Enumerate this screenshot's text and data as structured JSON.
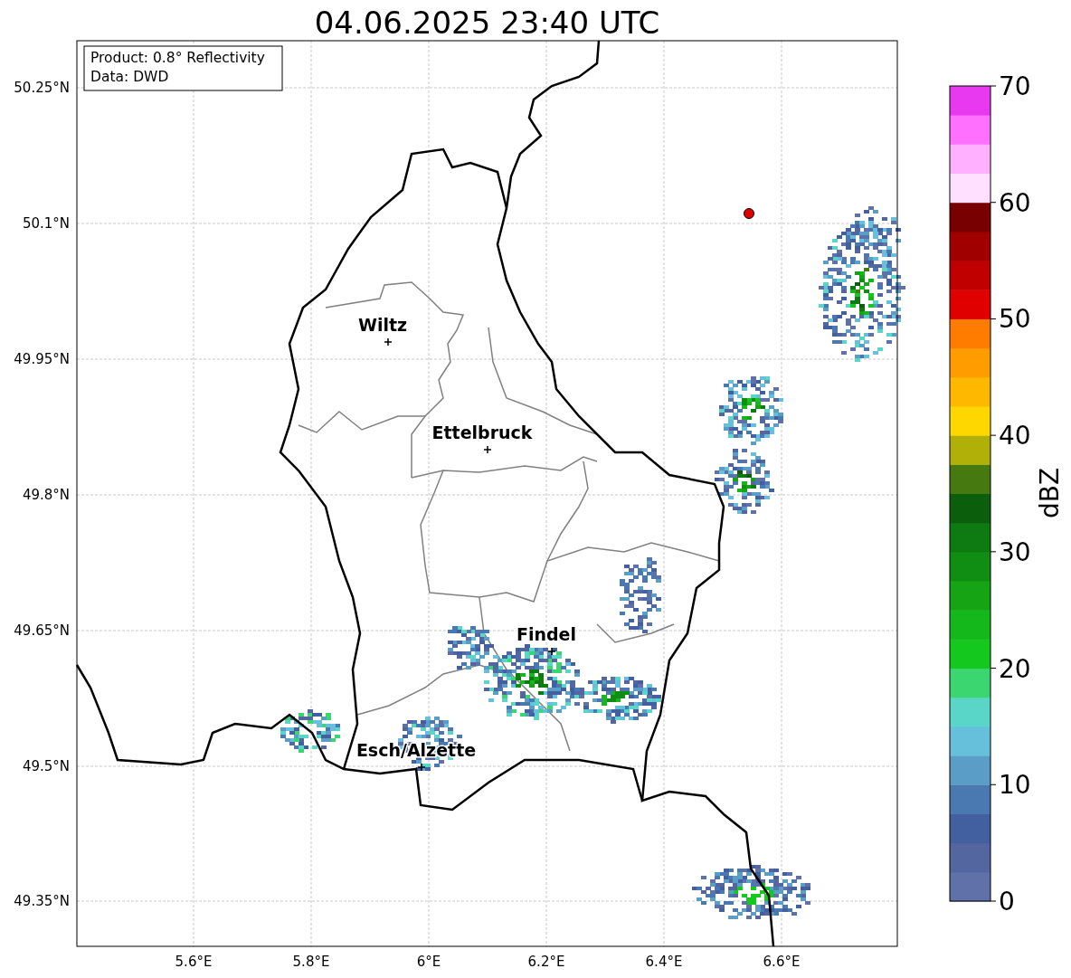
{
  "title": "04.06.2025 23:40 UTC",
  "info_box": {
    "lines": [
      "Product: 0.8° Reflectivity",
      "Data: DWD"
    ]
  },
  "map": {
    "lat_labels": [
      "50.25°N",
      "50.1°N",
      "49.95°N",
      "49.8°N",
      "49.65°N",
      "49.5°N",
      "49.35°N"
    ],
    "lon_labels": [
      "5.6°E",
      "5.8°E",
      "6°E",
      "6.2°E",
      "6.4°E",
      "6.6°E"
    ],
    "places": [
      {
        "name": "Wiltz"
      },
      {
        "name": "Ettelbruck"
      },
      {
        "name": "Findel"
      },
      {
        "name": "Esch/Alzette"
      }
    ]
  },
  "colorbar": {
    "label": "dBZ",
    "ticks": [
      "70",
      "60",
      "50",
      "40",
      "30",
      "20",
      "10",
      "0"
    ],
    "bands": [
      {
        "color": "#6070a8"
      },
      {
        "color": "#5366a0"
      },
      {
        "color": "#4260a0"
      },
      {
        "color": "#4a78b0"
      },
      {
        "color": "#5a9ec8"
      },
      {
        "color": "#66c0dc"
      },
      {
        "color": "#5ad6c8"
      },
      {
        "color": "#3cd670"
      },
      {
        "color": "#14c81e"
      },
      {
        "color": "#14b81a"
      },
      {
        "color": "#14a414"
      },
      {
        "color": "#108e14"
      },
      {
        "color": "#0e7a12"
      },
      {
        "color": "#0a5e0c"
      },
      {
        "color": "#467a10"
      },
      {
        "color": "#b0b008"
      },
      {
        "color": "#ffd700"
      },
      {
        "color": "#ffb800"
      },
      {
        "color": "#ff9c00"
      },
      {
        "color": "#ff7c00"
      },
      {
        "color": "#e00000"
      },
      {
        "color": "#c00000"
      },
      {
        "color": "#a00000"
      },
      {
        "color": "#780000"
      },
      {
        "color": "#ffe0ff"
      },
      {
        "color": "#ffb0ff"
      },
      {
        "color": "#ff70ff"
      },
      {
        "color": "#e838f0"
      }
    ]
  }
}
